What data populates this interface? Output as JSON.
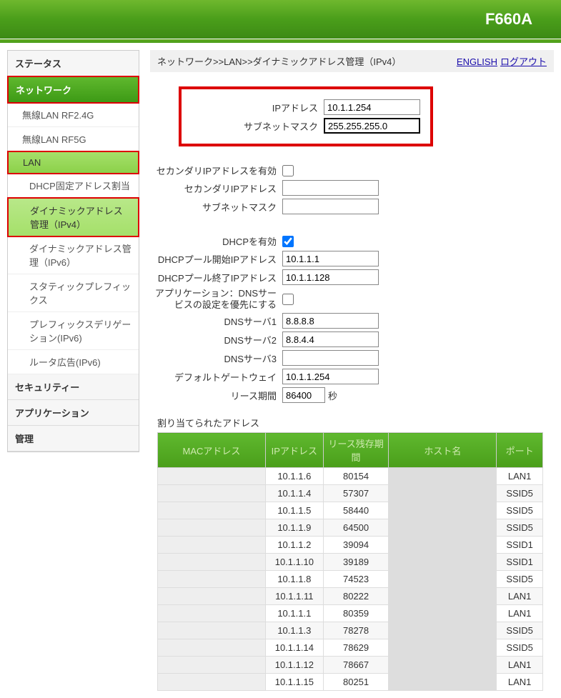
{
  "header": {
    "model": "F660A"
  },
  "breadcrumb": {
    "text": "ネットワーク>>LAN>>ダイナミックアドレス管理（IPv4）",
    "english": "ENGLISH",
    "logout": "ログアウト"
  },
  "sidebar": {
    "status": "ステータス",
    "network": "ネットワーク",
    "wlan24": "無線LAN RF2.4G",
    "wlan5": "無線LAN RF5G",
    "lan": "LAN",
    "dhcp_fixed": "DHCP固定アドレス割当",
    "dyn4": "ダイナミックアドレス管理（IPv4）",
    "dyn6": "ダイナミックアドレス管理（IPv6）",
    "static_prefix": "スタティックプレフィックス",
    "prefix_deleg": "プレフィックスデリゲーション(IPv6)",
    "ra": "ルータ広告(IPv6)",
    "security": "セキュリティー",
    "application": "アプリケーション",
    "admin": "管理"
  },
  "form": {
    "ip_label": "IPアドレス",
    "ip_value": "10.1.1.254",
    "mask_label": "サブネットマスク",
    "mask_value": "255.255.255.0",
    "sec_enable_label": "セカンダリIPアドレスを有効",
    "sec_enable": false,
    "sec_ip_label": "セカンダリIPアドレス",
    "sec_ip_value": "",
    "sec_mask_label": "サブネットマスク",
    "sec_mask_value": "",
    "dhcp_enable_label": "DHCPを有効",
    "dhcp_enable": true,
    "pool_start_label": "DHCPプール開始IPアドレス",
    "pool_start_value": "10.1.1.1",
    "pool_end_label": "DHCPプール終了IPアドレス",
    "pool_end_value": "10.1.1.128",
    "app_dns_label": "アプリケーション：DNSサービスの設定を優先にする",
    "app_dns": false,
    "dns1_label": "DNSサーバ1",
    "dns1_value": "8.8.8.8",
    "dns2_label": "DNSサーバ2",
    "dns2_value": "8.8.4.4",
    "dns3_label": "DNSサーバ3",
    "dns3_value": "",
    "gw_label": "デフォルトゲートウェイ",
    "gw_value": "10.1.1.254",
    "lease_label": "リース期間",
    "lease_value": "86400",
    "lease_unit": "秒"
  },
  "alloc": {
    "title": "割り当てられたアドレス",
    "headers": {
      "mac": "MACアドレス",
      "ip": "IPアドレス",
      "lease": "リース残存期間",
      "host": "ホスト名",
      "port": "ポート"
    },
    "rows": [
      {
        "mac": "",
        "ip": "10.1.1.6",
        "lease": "80154",
        "host": "",
        "port": "LAN1"
      },
      {
        "mac": "",
        "ip": "10.1.1.4",
        "lease": "57307",
        "host": "",
        "port": "SSID5"
      },
      {
        "mac": "",
        "ip": "10.1.1.5",
        "lease": "58440",
        "host": "",
        "port": "SSID5"
      },
      {
        "mac": "",
        "ip": "10.1.1.9",
        "lease": "64500",
        "host": "",
        "port": "SSID5"
      },
      {
        "mac": "",
        "ip": "10.1.1.2",
        "lease": "39094",
        "host": "",
        "port": "SSID1"
      },
      {
        "mac": "",
        "ip": "10.1.1.10",
        "lease": "39189",
        "host": "",
        "port": "SSID1"
      },
      {
        "mac": "",
        "ip": "10.1.1.8",
        "lease": "74523",
        "host": "",
        "port": "SSID5"
      },
      {
        "mac": "",
        "ip": "10.1.1.11",
        "lease": "80222",
        "host": "",
        "port": "LAN1"
      },
      {
        "mac": "",
        "ip": "10.1.1.1",
        "lease": "80359",
        "host": "",
        "port": "LAN1"
      },
      {
        "mac": "",
        "ip": "10.1.1.3",
        "lease": "78278",
        "host": "",
        "port": "SSID5"
      },
      {
        "mac": "",
        "ip": "10.1.1.14",
        "lease": "78629",
        "host": "",
        "port": "SSID5"
      },
      {
        "mac": "",
        "ip": "10.1.1.12",
        "lease": "78667",
        "host": "",
        "port": "LAN1"
      },
      {
        "mac": "",
        "ip": "10.1.1.15",
        "lease": "80251",
        "host": "",
        "port": "LAN1"
      }
    ]
  }
}
